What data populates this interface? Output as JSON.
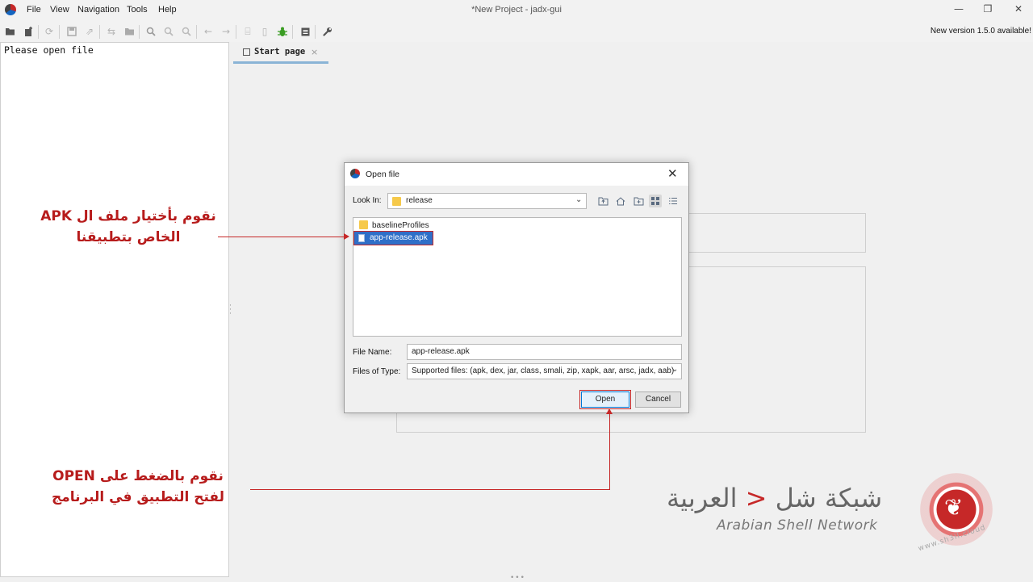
{
  "window": {
    "title": "*New Project - jadx-gui"
  },
  "menu": [
    "File",
    "View",
    "Navigation",
    "Tools",
    "Help"
  ],
  "window_controls": {
    "minimize": "—",
    "maximize": "❐",
    "close": "✕"
  },
  "toolbar": {
    "update_notice": "New version 1.5.0 available!"
  },
  "left_panel": {
    "placeholder": "Please open file"
  },
  "tabs": [
    {
      "label": "Start page",
      "close": "×"
    }
  ],
  "dialog": {
    "title": "Open file",
    "close": "✕",
    "look_in_label": "Look In:",
    "look_in_value": "release",
    "files": [
      {
        "name": "baselineProfiles",
        "type": "folder"
      },
      {
        "name": "app-release.apk",
        "type": "file",
        "selected": true
      }
    ],
    "file_name_label": "File Name:",
    "file_name_value": "app-release.apk",
    "file_type_label": "Files of Type:",
    "file_type_value": "Supported files: (apk, dex, jar, class, smali, zip, xapk, aar, arsc, jadx, aab)",
    "open_label": "Open",
    "cancel_label": "Cancel"
  },
  "annotations": {
    "select_apk_line1": "نقوم بأختيار ملف ال APK",
    "select_apk_line2": "الخاص بتطبيقنا",
    "press_open_line1": "نقوم بالضغط على OPEN",
    "press_open_line2": "لفتح التطبيق في البرنامج"
  },
  "watermark": {
    "name_part1": "شبكة شل",
    "caret": "<",
    "name_part2": "العربية",
    "subtitle": "Arabian Shell Network",
    "url": "www.sh3ll.cloud"
  },
  "colors": {
    "accent_red": "#c62828",
    "selection_blue": "#2f6fc8"
  }
}
